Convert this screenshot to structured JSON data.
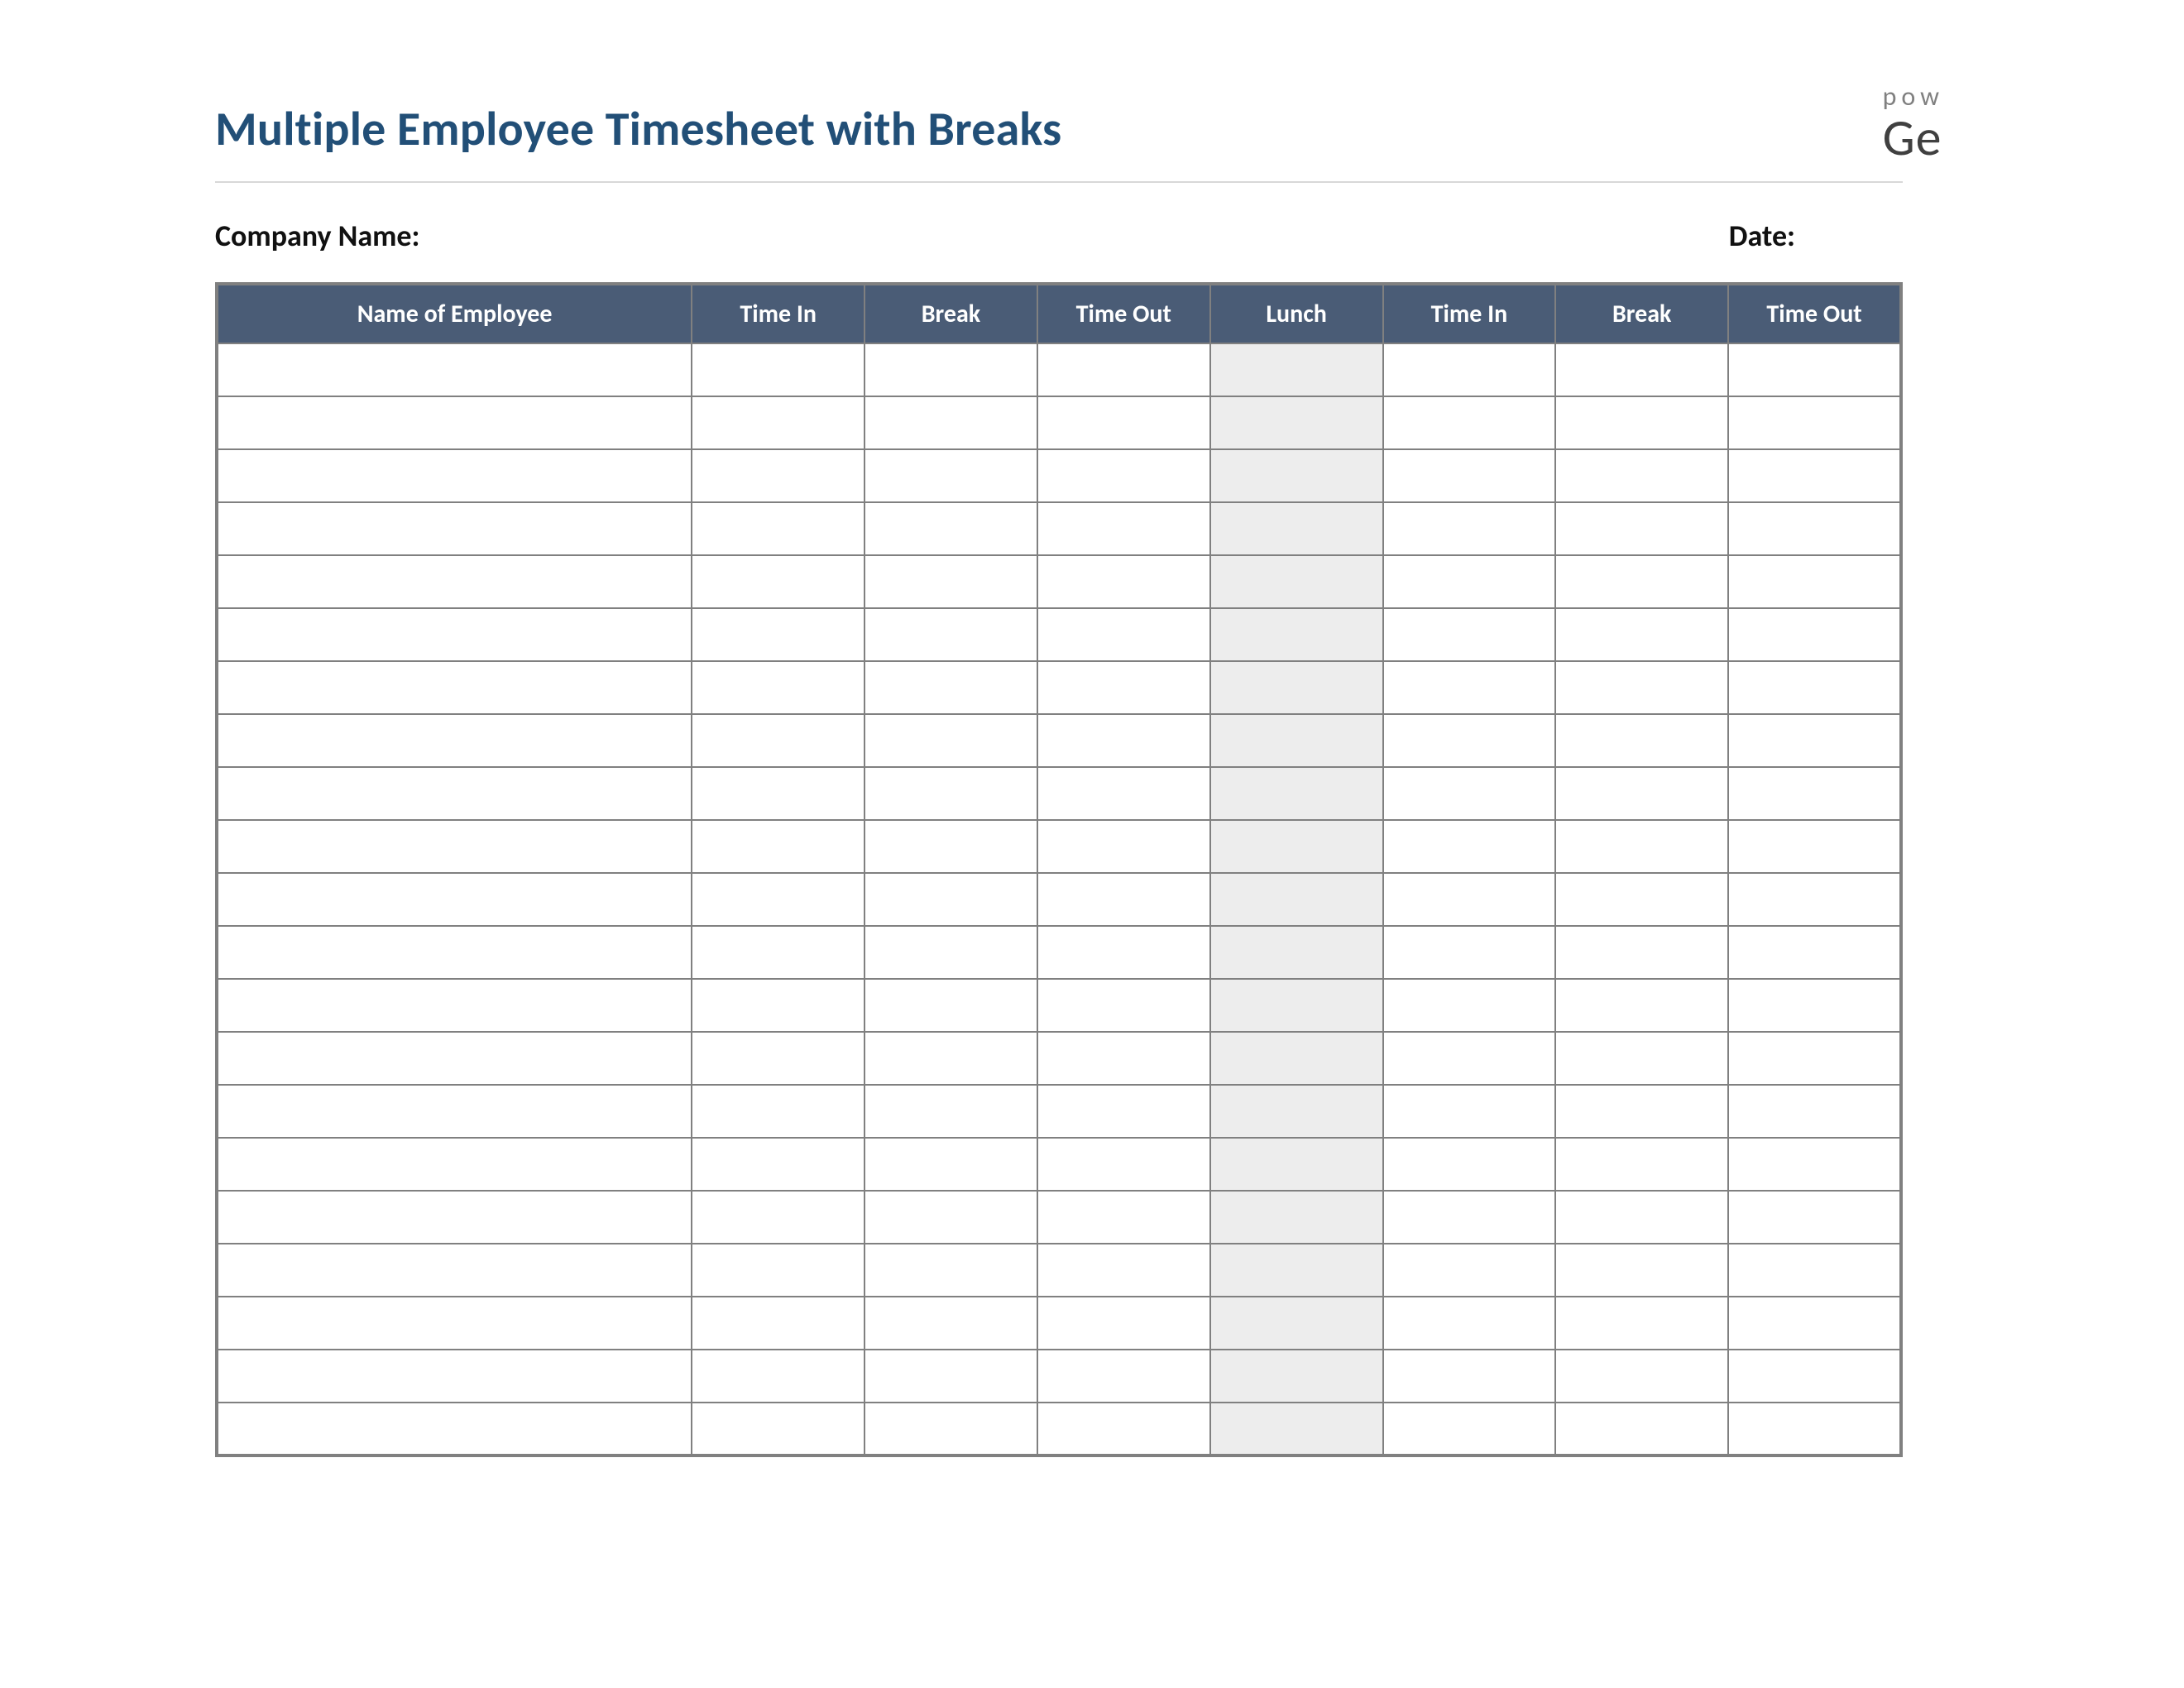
{
  "document": {
    "title": "Multiple Employee Timesheet with Breaks",
    "brand_fragment_top": "pow",
    "brand_fragment_bottom": "Ge",
    "labels": {
      "company_name": "Company Name:",
      "date": "Date:"
    },
    "fields": {
      "company_name_value": "",
      "date_value": ""
    },
    "table": {
      "columns": [
        "Name of Employee",
        "Time In",
        "Break",
        "Time Out",
        "Lunch",
        "Time In",
        "Break",
        "Time Out"
      ],
      "shaded_column_index": 4,
      "row_count": 21,
      "rows": [
        [
          "",
          "",
          "",
          "",
          "",
          "",
          "",
          ""
        ],
        [
          "",
          "",
          "",
          "",
          "",
          "",
          "",
          ""
        ],
        [
          "",
          "",
          "",
          "",
          "",
          "",
          "",
          ""
        ],
        [
          "",
          "",
          "",
          "",
          "",
          "",
          "",
          ""
        ],
        [
          "",
          "",
          "",
          "",
          "",
          "",
          "",
          ""
        ],
        [
          "",
          "",
          "",
          "",
          "",
          "",
          "",
          ""
        ],
        [
          "",
          "",
          "",
          "",
          "",
          "",
          "",
          ""
        ],
        [
          "",
          "",
          "",
          "",
          "",
          "",
          "",
          ""
        ],
        [
          "",
          "",
          "",
          "",
          "",
          "",
          "",
          ""
        ],
        [
          "",
          "",
          "",
          "",
          "",
          "",
          "",
          ""
        ],
        [
          "",
          "",
          "",
          "",
          "",
          "",
          "",
          ""
        ],
        [
          "",
          "",
          "",
          "",
          "",
          "",
          "",
          ""
        ],
        [
          "",
          "",
          "",
          "",
          "",
          "",
          "",
          ""
        ],
        [
          "",
          "",
          "",
          "",
          "",
          "",
          "",
          ""
        ],
        [
          "",
          "",
          "",
          "",
          "",
          "",
          "",
          ""
        ],
        [
          "",
          "",
          "",
          "",
          "",
          "",
          "",
          ""
        ],
        [
          "",
          "",
          "",
          "",
          "",
          "",
          "",
          ""
        ],
        [
          "",
          "",
          "",
          "",
          "",
          "",
          "",
          ""
        ],
        [
          "",
          "",
          "",
          "",
          "",
          "",
          "",
          ""
        ],
        [
          "",
          "",
          "",
          "",
          "",
          "",
          "",
          ""
        ],
        [
          "",
          "",
          "",
          "",
          "",
          "",
          "",
          ""
        ]
      ]
    },
    "colors": {
      "title_color": "#224f77",
      "header_bg": "#4a5c76",
      "header_text": "#ffffff",
      "grid_border": "#808080",
      "lunch_shade": "#ededed",
      "divider": "#d8d8d8"
    }
  }
}
